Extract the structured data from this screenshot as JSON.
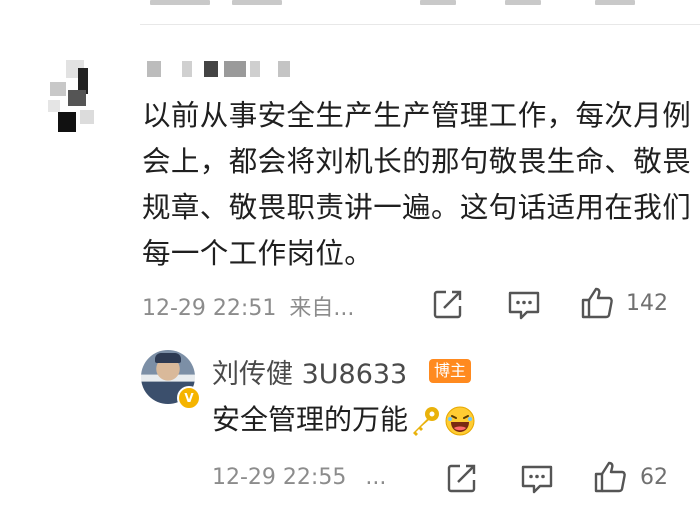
{
  "comment": {
    "text": "以前从事安全生产生产管理工作，每次月例会上，都会将刘机长的那句敬畏生命、敬畏规章、敬畏职责讲一遍。这句话适用在我们每一个工作岗位。",
    "time": "12-29 22:51",
    "source": "来自...",
    "like_count": "142"
  },
  "reply": {
    "author": "刘传健 3U8633",
    "badge": "博主",
    "text": "安全管理的万能",
    "time": "12-29 22:55",
    "more": "...",
    "like_count": "62"
  },
  "icons": {
    "share": "share-icon",
    "comment": "comment-icon",
    "like": "thumbs-up-icon",
    "key": "key-icon",
    "laugh": "laughing-emoji-icon"
  },
  "colors": {
    "badge_orange": "#ff8a1f",
    "verify_gold": "#f5b400",
    "key_gold": "#e9b20b",
    "meta_gray": "#8c8c8c"
  }
}
